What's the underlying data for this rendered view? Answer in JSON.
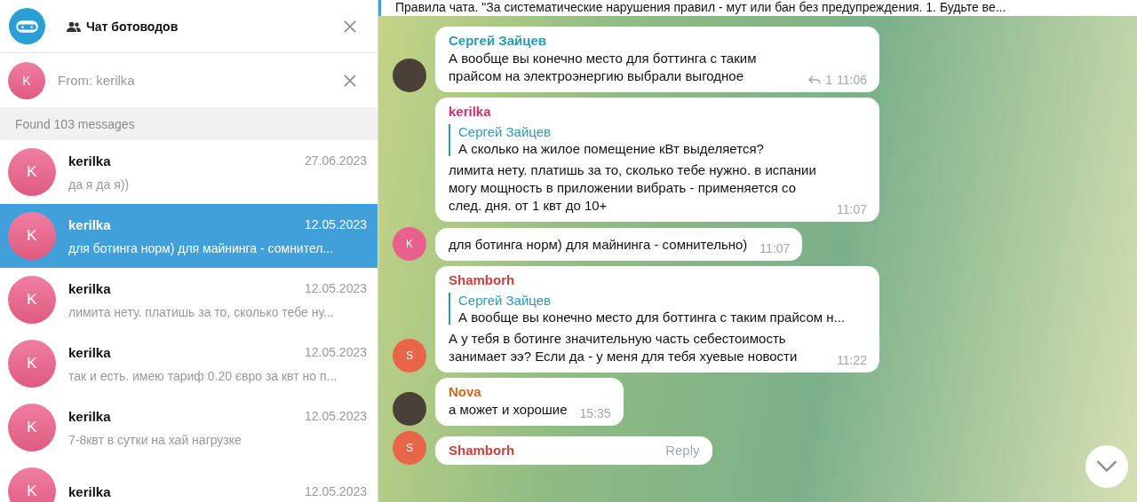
{
  "sidebar": {
    "chat_title": "Чат ботоводов",
    "search_filter": {
      "avatar_letter": "K",
      "placeholder": "From: kerilka"
    },
    "results_count": "Found 103 messages",
    "results": [
      {
        "avatar_letter": "K",
        "name": "kerilka",
        "date": "27.06.2023",
        "preview": "да я да я))",
        "selected": false
      },
      {
        "avatar_letter": "K",
        "name": "kerilka",
        "date": "12.05.2023",
        "preview": "для ботинга норм) для майнинга - сомнител...",
        "selected": true
      },
      {
        "avatar_letter": "K",
        "name": "kerilka",
        "date": "12.05.2023",
        "preview": "лимита нету. платишь за то, сколько тебе ну...",
        "selected": false
      },
      {
        "avatar_letter": "K",
        "name": "kerilka",
        "date": "12.05.2023",
        "preview": "так и есть. имею тариф 0.20 євро за квт но п...",
        "selected": false
      },
      {
        "avatar_letter": "K",
        "name": "kerilka",
        "date": "12.05.2023",
        "preview": "7-8квт в сутки на хай нагрузке",
        "selected": false
      },
      {
        "avatar_letter": "K",
        "name": "kerilka",
        "date": "12.05.2023",
        "selected": false
      }
    ]
  },
  "chat": {
    "pinned_message": "Правила чата. \"За систематические нарушения правил - мут или бан без предупреждения. 1. Будьте ве...",
    "messages": [
      {
        "sender": "Сергей Зайцев",
        "color": "#2a9bb5",
        "avatar": {
          "kind": "photo"
        },
        "text": "А вообще вы конечно место для боттинга с таким прайсом на электроэнергию выбрали выгодное",
        "replies": "1",
        "time": "11:06"
      },
      {
        "sender": "kerilka",
        "color": "#d0306c",
        "reply_to": {
          "name": "Сергей Зайцев",
          "text": "А сколько на жилое помещение кВт выделяется?"
        },
        "text": "лимита нету. платишь за то, сколько тебе нужно. в испании могу мощность в приложении вибрать - применяется со след. дня. от 1 квт до 10+",
        "time": "11:07"
      },
      {
        "avatar": {
          "kind": "letter",
          "letter": "K",
          "color": "#e8618c"
        },
        "text": "для ботинга норм) для майнинга - сомнительно)",
        "time": "11:07"
      },
      {
        "sender": "Shamborh",
        "color": "#c8413b",
        "avatar": {
          "kind": "letter",
          "letter": "S",
          "color": "#e8654a"
        },
        "reply_to": {
          "name": "Сергей Зайцев",
          "text": "А вообще вы конечно место для боттинга с таким прайсом н..."
        },
        "text": "А у тебя в ботинге значительную часть себестоимость занимает ээ? Если да - у меня для тебя хуевые новости",
        "time": "11:22"
      },
      {
        "sender": "Nova",
        "color": "#d2691e",
        "avatar": {
          "kind": "photo"
        },
        "text": "а может и хорошие",
        "time": "15:35"
      },
      {
        "sender": "Shamborh",
        "color": "#c8413b",
        "avatar": {
          "kind": "letter",
          "letter": "S",
          "color": "#e8654a"
        },
        "action": "Reply"
      }
    ]
  }
}
